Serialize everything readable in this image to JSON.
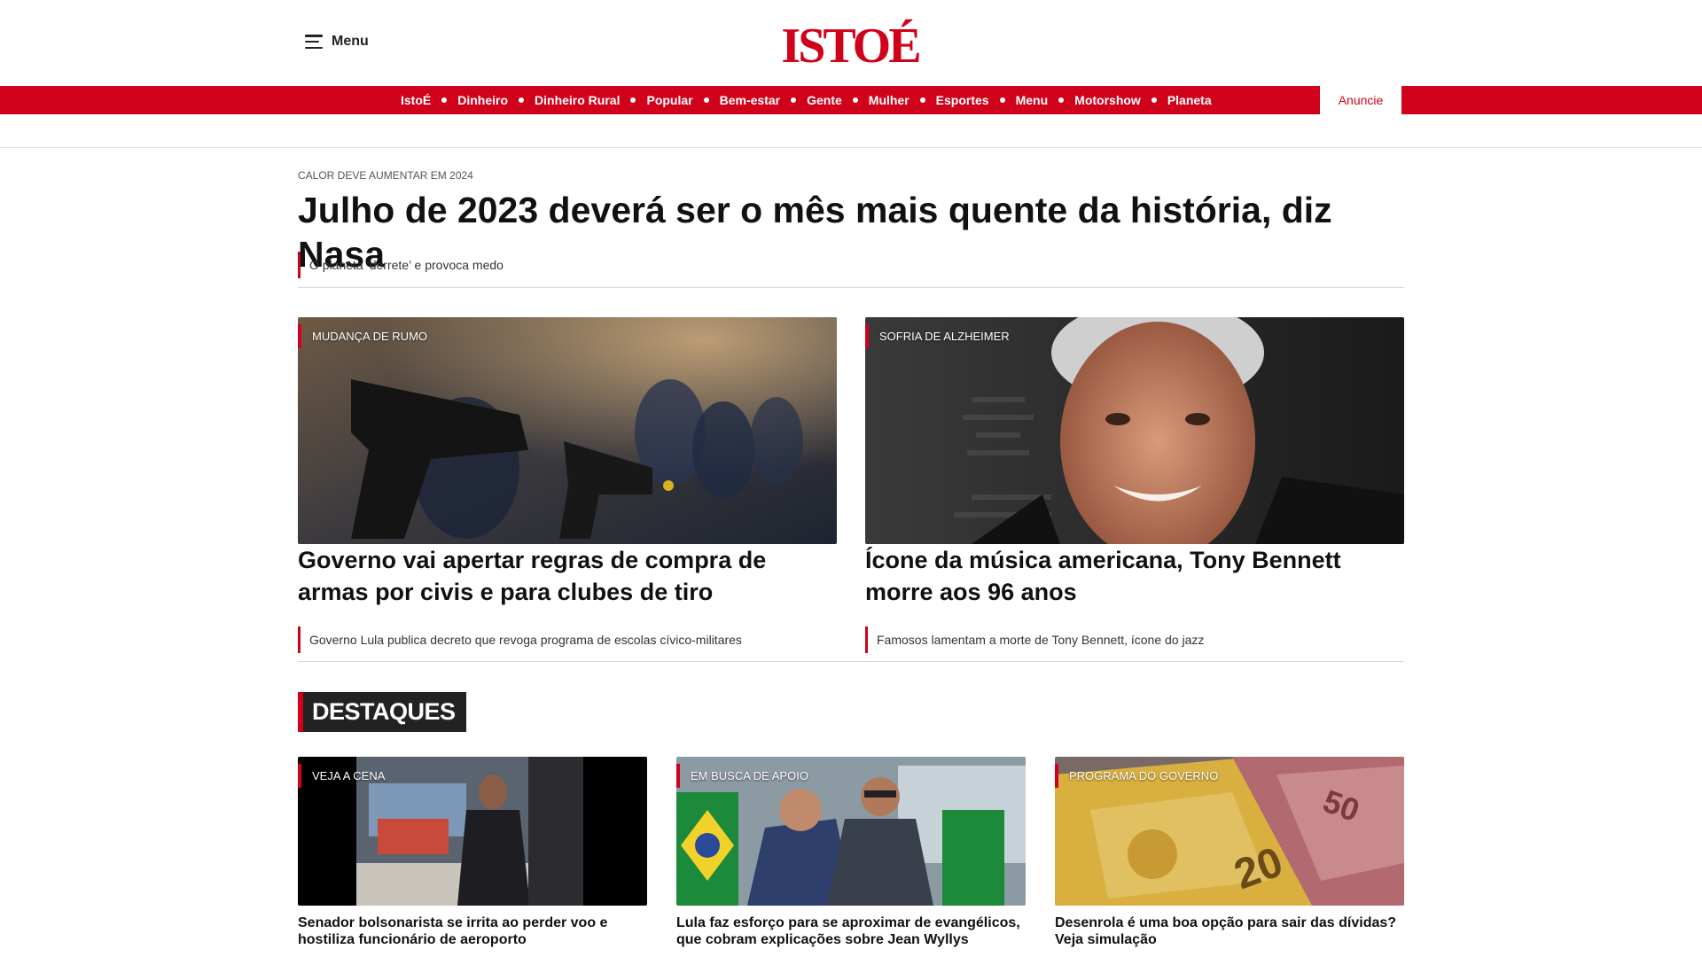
{
  "header": {
    "menu_label": "Menu",
    "logo_text": "ISTOÉ"
  },
  "nav": {
    "items": [
      "IstoÉ",
      "Dinheiro",
      "Dinheiro Rural",
      "Popular",
      "Bem-estar",
      "Gente",
      "Mulher",
      "Esportes",
      "Menu",
      "Motorshow",
      "Planeta"
    ],
    "anuncie": "Anuncie"
  },
  "lead": {
    "kicker": "CALOR DEVE AUMENTAR EM 2024",
    "title": "Julho de 2023 deverá ser o mês mais quente da história, diz Nasa",
    "related": "O planeta ‘derrete’ e provoca medo"
  },
  "featured": [
    {
      "tag": "MUDANÇA DE RUMO",
      "title": "Governo vai apertar regras de compra de armas por civis e para clubes de tiro",
      "related": "Governo Lula publica decreto que revoga programa de escolas cívico-militares"
    },
    {
      "tag": "SOFRIA DE ALZHEIMER",
      "title": "Ícone da música americana, Tony Bennett morre aos 96 anos",
      "related": "Famosos lamentam a morte de Tony Bennett, ícone do jazz"
    }
  ],
  "section": {
    "title": "DESTAQUES"
  },
  "highlights": [
    {
      "tag": "VEJA A CENA",
      "title": "Senador bolsonarista se irrita ao perder voo e hostiliza funcionário de aeroporto"
    },
    {
      "tag": "EM BUSCA DE APOIO",
      "title": "Lula faz esforço para se aproximar de evangélicos, que cobram explicações sobre Jean Wyllys"
    },
    {
      "tag": "PROGRAMA DO GOVERNO",
      "title": "Desenrola é uma boa opção para sair das dívidas? Veja simulação"
    }
  ],
  "colors": {
    "brand_red": "#d0021b",
    "text_dark": "#111111"
  }
}
